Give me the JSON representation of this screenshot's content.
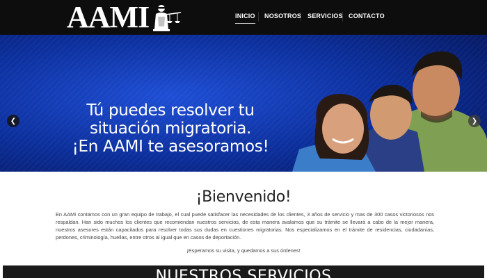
{
  "header": {
    "logo_text": "AAMI",
    "logo_emblem": "justice-scales-lady-icon",
    "nav": [
      {
        "label": "INICIO",
        "active": true
      },
      {
        "label": "NOSOTROS",
        "active": false
      },
      {
        "label": "SERVICIOS",
        "active": false
      },
      {
        "label": "CONTACTO",
        "active": false
      }
    ]
  },
  "hero": {
    "lines": [
      "Tú puedes resolver tu",
      "situación migratoria.",
      "¡En AAMI te asesoramos!"
    ],
    "prev_icon": "chevron-left-icon",
    "next_icon": "chevron-right-icon",
    "slide_count": 3,
    "active_slide": 2,
    "image": "family-photo"
  },
  "welcome": {
    "title": "¡Bienvenido!",
    "body": "En AAMI contamos con un gran equipo de trabajo, el cual puede satisfacer las necesidades de los clientes, 3 años de servicio y mas de 300 casos victoriosos nos respaldan. Han sido muchos los  clientes que recomiendan nuestros servicios,  de esta manera avalamos que su trámite se llevará a cabo de la mejor manera, nuestros asesores están capacitados para resolver todas sus dudas en cuestiones migratorias. Nos especializamos en el trámite de residencias, ciudadanías, perdones, criminología, huellas, entre otros al igual que en casos de deportación.",
    "closing": "¡Esperamos su visita, y quedamos a sus órdenes!"
  },
  "services": {
    "title": "NUESTROS SERVICIOS"
  },
  "colors": {
    "header_bg": "#0d0d0d",
    "hero_blue": "#0b2a8c",
    "services_bg": "#1a1a1a"
  }
}
